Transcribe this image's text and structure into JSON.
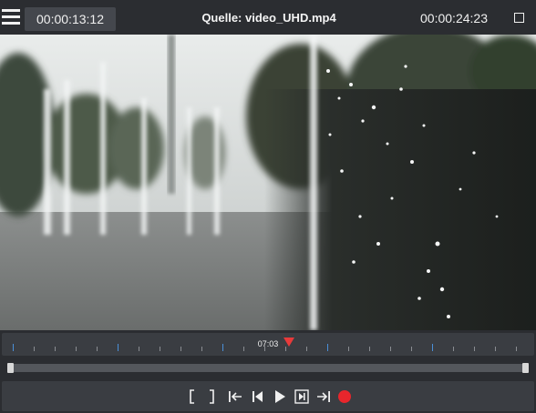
{
  "header": {
    "current_time": "00:00:13:12",
    "title": "Quelle: video_UHD.mp4",
    "end_time": "00:00:24:23"
  },
  "timeline": {
    "playhead_label": "07:03",
    "playhead_color": "#e83a3a",
    "tick_color": "#4a90d9"
  },
  "scrubber": {
    "in_point": 0,
    "out_point": 1
  },
  "controls": {
    "buttons": [
      "set-in-point",
      "set-out-point",
      "go-to-in-point",
      "step-back",
      "play",
      "step-forward",
      "go-to-out-point",
      "record"
    ],
    "record_color": "#e8262c"
  }
}
